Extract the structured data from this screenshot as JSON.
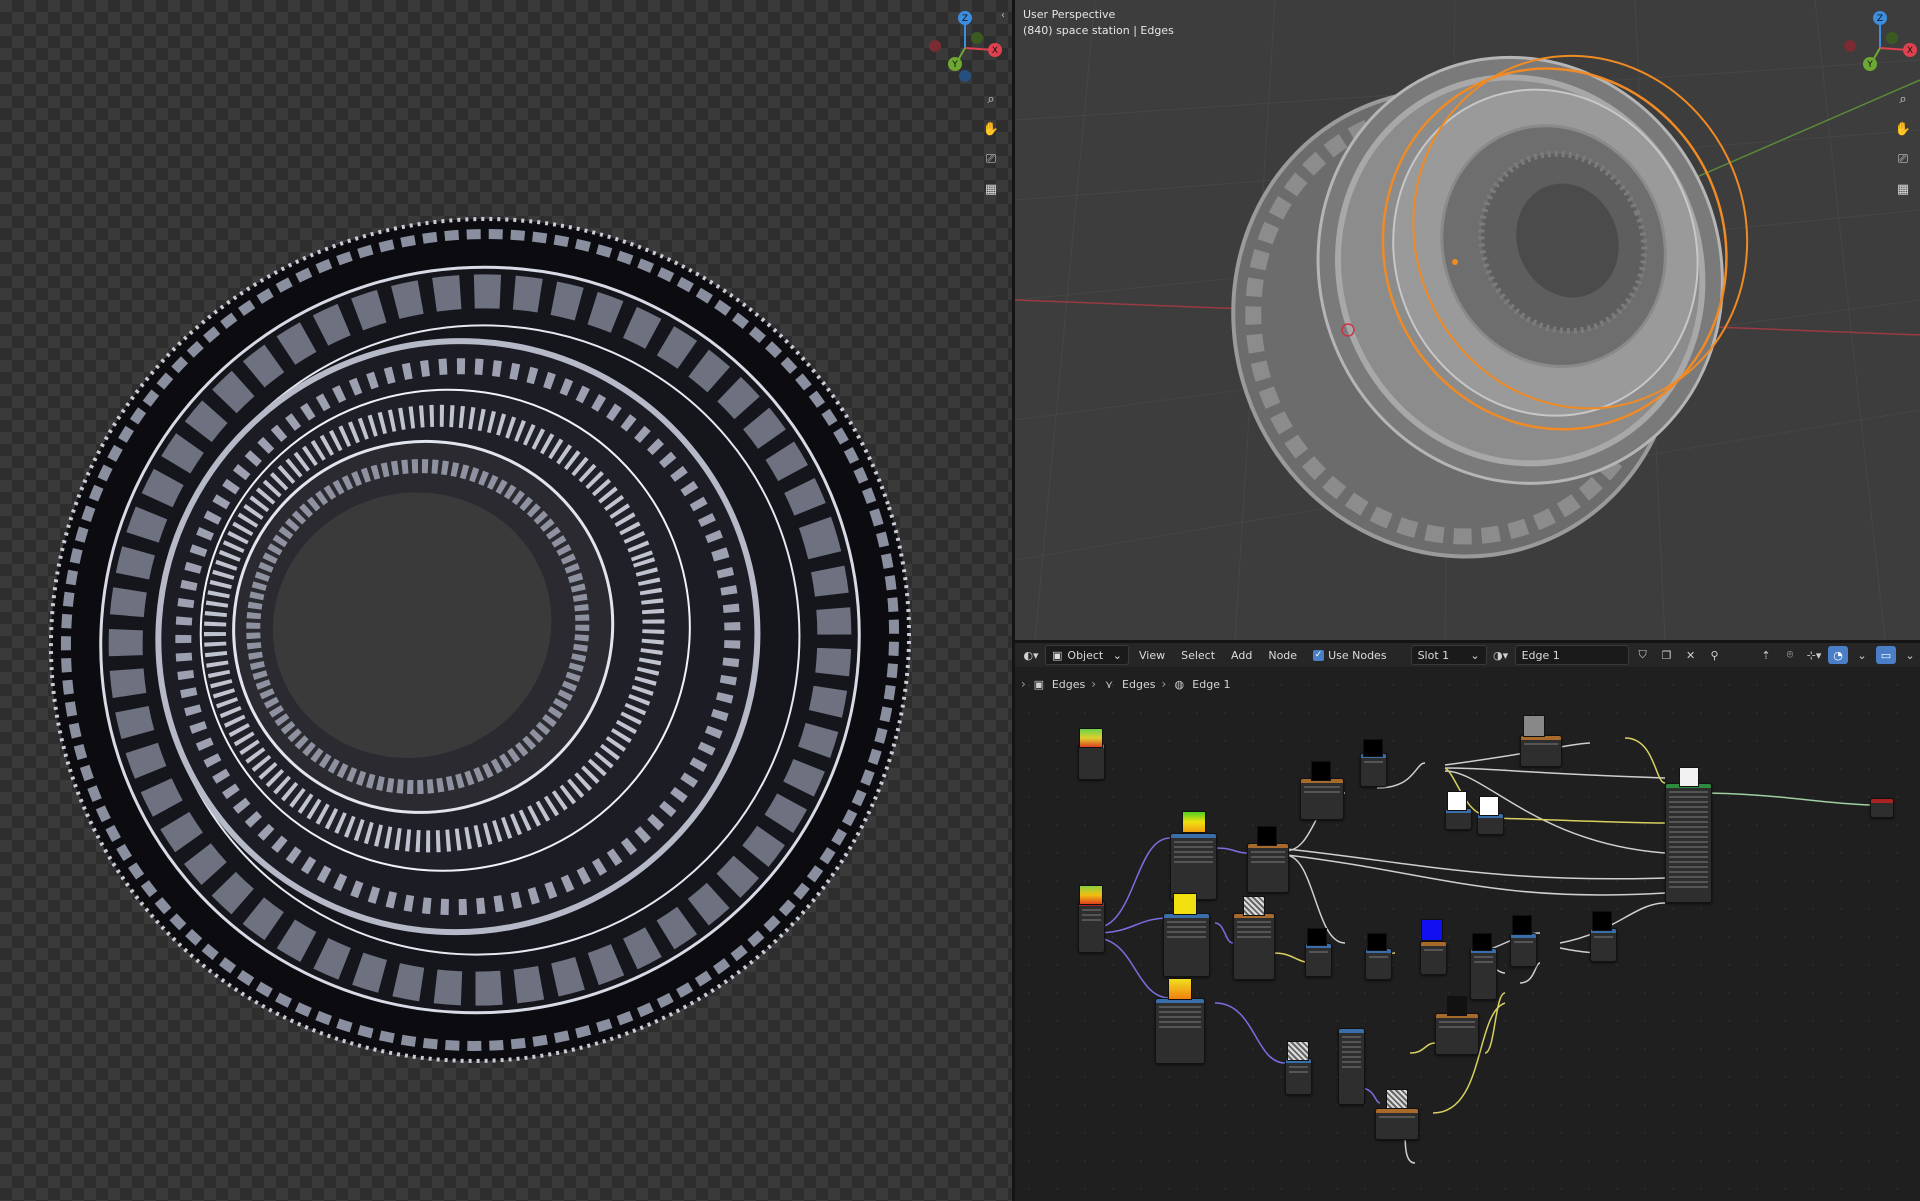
{
  "viewport3d": {
    "perspective_label": "User Perspective",
    "object_info": "(840) space station | Edges"
  },
  "node_editor": {
    "header": {
      "object_mode": "Object",
      "menu": [
        "View",
        "Select",
        "Add",
        "Node"
      ],
      "use_nodes_label": "Use Nodes",
      "use_nodes_checked": true,
      "slot": "Slot 1",
      "material": "Edge 1"
    },
    "breadcrumb": [
      "Edges",
      "Edges",
      "Edge 1"
    ]
  },
  "gizmo": {
    "axes": [
      "X",
      "Y",
      "Z"
    ],
    "x_color": "#e0414f",
    "y_color": "#6ca832",
    "z_color": "#3d8ee0"
  },
  "icons": {
    "zoom": "zoom-icon",
    "pan": "hand-icon",
    "camera": "camera-icon",
    "grid": "ortho-grid-icon"
  },
  "colors": {
    "selection_outline": "#f08a24",
    "accent_blue": "#4a7fc8"
  }
}
